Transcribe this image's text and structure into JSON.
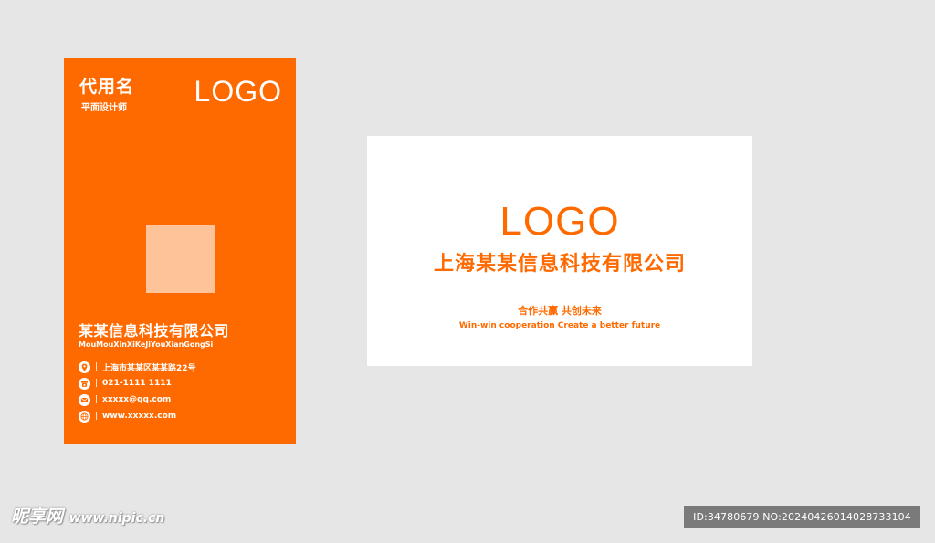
{
  "front": {
    "name": "代用名",
    "job_title": "平面设计师",
    "logo": "LOGO",
    "company_cn": "某某信息科技有限公司",
    "company_pinyin": "MouMouXinXiKeJiYouXianGongSi",
    "contacts": [
      {
        "icon": "location-pin-icon",
        "text": "上海市某某区某某路22号"
      },
      {
        "icon": "phone-icon",
        "text": "021-1111 1111"
      },
      {
        "icon": "mail-icon",
        "text": "xxxxx@qq.com"
      },
      {
        "icon": "globe-icon",
        "text": "www.xxxxx.com"
      }
    ],
    "separator": "|"
  },
  "back": {
    "logo": "LOGO",
    "company_cn": "上海某某信息科技有限公司",
    "slogan_cn": "合作共赢 共创未来",
    "slogan_en": "Win-win cooperation Create a better future"
  },
  "watermark": {
    "site_cn": "昵享网",
    "site_url": "www.nipic.cn",
    "id_text": "ID:34780679 NO:20240426014028733104"
  },
  "colors": {
    "brand_orange": "#ff6a00",
    "photo_placeholder": "#ffc39a",
    "background": "#e6e6e6",
    "card_back": "#ffffff"
  }
}
